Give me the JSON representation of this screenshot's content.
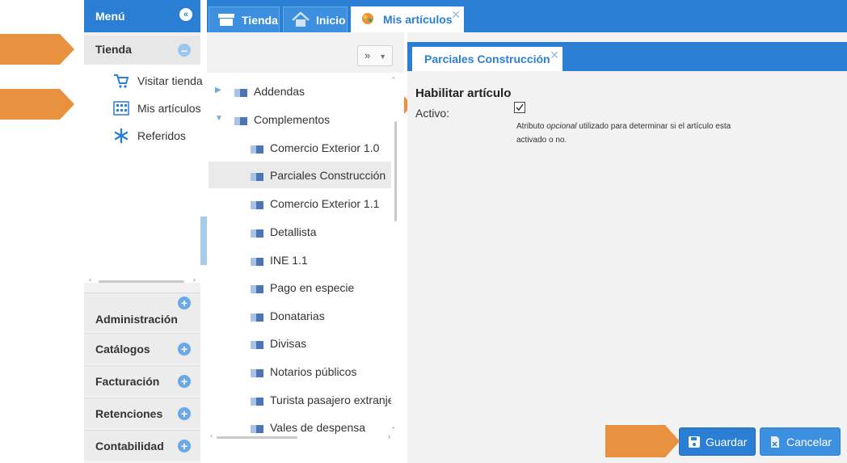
{
  "sidebar": {
    "title": "Menú",
    "open_section": "Tienda",
    "items": [
      {
        "label": "Visitar tienda"
      },
      {
        "label": "Mis artículos"
      },
      {
        "label": "Referidos"
      }
    ],
    "sections": [
      {
        "label": "Administración"
      },
      {
        "label": "Catálogos"
      },
      {
        "label": "Facturación"
      },
      {
        "label": "Retenciones"
      },
      {
        "label": "Contabilidad"
      }
    ]
  },
  "tabs": [
    {
      "label": "Tienda"
    },
    {
      "label": "Inicio"
    },
    {
      "label": "Mis artículos"
    }
  ],
  "tree": {
    "expand_label": "»",
    "nodes": [
      {
        "label": "Addendas"
      },
      {
        "label": "Complementos"
      },
      {
        "label": "Comercio Exterior 1.0"
      },
      {
        "label": "Parciales Construcción"
      },
      {
        "label": "Comercio Exterior 1.1"
      },
      {
        "label": "Detallista"
      },
      {
        "label": "INE 1.1"
      },
      {
        "label": "Pago en especie"
      },
      {
        "label": "Donatarias"
      },
      {
        "label": "Divisas"
      },
      {
        "label": "Notarios públicos"
      },
      {
        "label": "Turista pasajero extranjei"
      },
      {
        "label": "Vales de despensa"
      }
    ]
  },
  "form": {
    "tab_label": "Parciales Construcción",
    "section_title": "Habilitar artículo",
    "field_label": "Activo:",
    "checked": true,
    "help_before": "Atributo ",
    "help_em": "opcional",
    "help_after": " utilizado para determinar si el artículo esta activado o no.",
    "save_label": "Guardar",
    "cancel_label": "Cancelar"
  },
  "colors": {
    "accent": "#2a7fd4",
    "annotation": "#e8913f"
  }
}
